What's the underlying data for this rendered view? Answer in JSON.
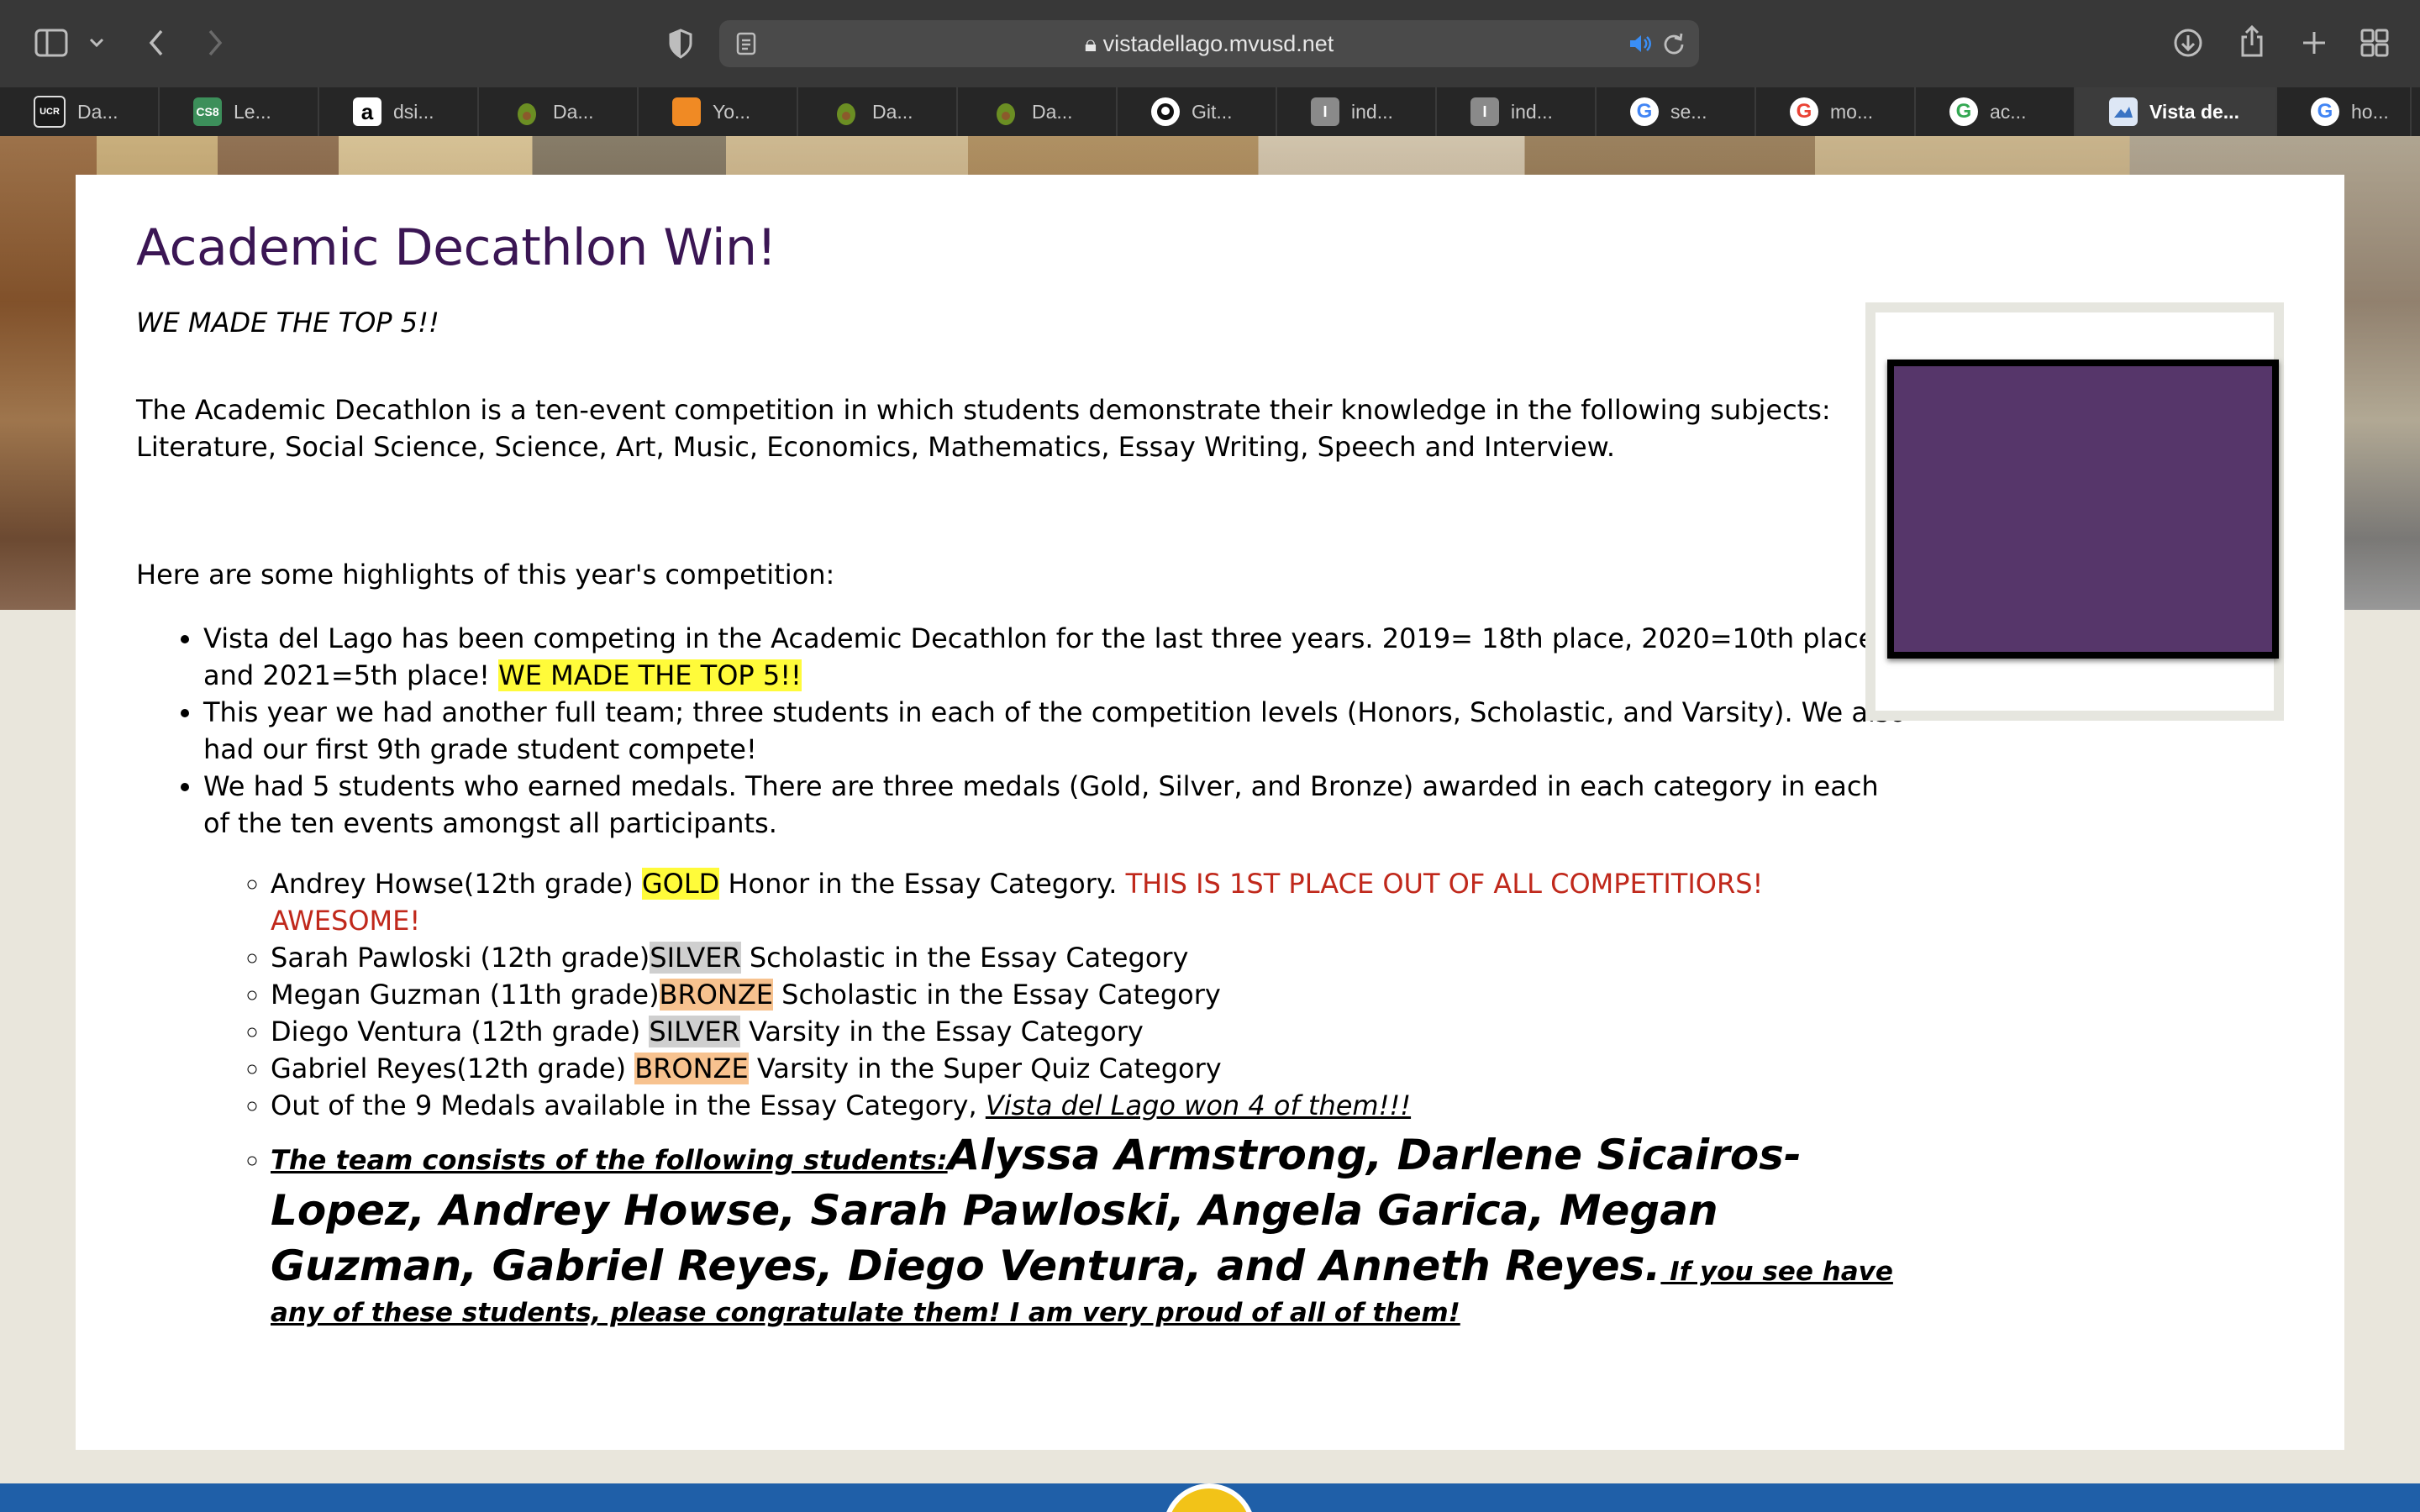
{
  "browser": {
    "url": "vistadellago.mvusd.net",
    "tabs": [
      {
        "label": "Da...",
        "icon": "ucr-learn-icon",
        "color": "#1a1a1a"
      },
      {
        "label": "Le...",
        "icon": "cs8-icon",
        "color": "#3c8f5a"
      },
      {
        "label": "dsi...",
        "icon": "amazon-icon",
        "color": "#ffffff"
      },
      {
        "label": "Da...",
        "icon": "avocado-icon",
        "color": "#6b8e23"
      },
      {
        "label": "Yo...",
        "icon": "orange-box-icon",
        "color": "#f08a24"
      },
      {
        "label": "Da...",
        "icon": "avocado-icon",
        "color": "#6b8e23"
      },
      {
        "label": "Da...",
        "icon": "avocado-icon",
        "color": "#6b8e23"
      },
      {
        "label": "Git...",
        "icon": "github-icon",
        "color": "#ffffff"
      },
      {
        "label": "ind...",
        "icon": "i-icon",
        "color": "#8a8a8a"
      },
      {
        "label": "ind...",
        "icon": "i-icon",
        "color": "#8a8a8a"
      },
      {
        "label": "se...",
        "icon": "google-icon",
        "color": "#ffffff"
      },
      {
        "label": "mo...",
        "icon": "google-icon",
        "color": "#ffffff"
      },
      {
        "label": "ac...",
        "icon": "google-icon",
        "color": "#ffffff"
      },
      {
        "label": "Vista de...",
        "icon": "vista-icon",
        "color": "#dde7f5",
        "active": true
      },
      {
        "label": "ho...",
        "icon": "google-icon",
        "color": "#ffffff"
      }
    ]
  },
  "article": {
    "title": "Academic Decathlon Win!",
    "subtitle": "WE MADE THE TOP 5!!",
    "intro": "The Academic Decathlon is a ten-event competition in which students demonstrate their knowledge in the following subjects: Literature, Social Science, Science, Art, Music, Economics, Mathematics, Essay Writing, Speech and Interview.",
    "highlights_intro": "Here are some highlights of this year's competition:",
    "bullet1_text": "Vista del Lago has been competing in the Academic Decathlon for the last three years. 2019= 18th place, 2020=10th place, and 2021=5th place! ",
    "bullet1_highlight": "WE MADE THE TOP 5!!",
    "bullet2": "This year we had another full team; three students in each of the competition levels (Honors, Scholastic, and Varsity). We also had our first 9th grade student compete!",
    "bullet3": "We had 5 students who earned medals. There are three medals (Gold, Silver, and Bronze) awarded in each category in each of the ten events amongst all participants.",
    "medals": {
      "m1_pre": "Andrey Howse(12th grade) ",
      "m1_medal": "GOLD",
      "m1_post": " Honor in the Essay Category. ",
      "m1_red": "THIS IS 1ST PLACE OUT OF ALL COMPETITIORS! AWESOME!",
      "m2_pre": "Sarah Pawloski (12th grade)",
      "m2_medal": "SILVER",
      "m2_post": " Scholastic in the Essay Category",
      "m3_pre": "Megan Guzman (11th grade)",
      "m3_medal": "BRONZE",
      "m3_post": " Scholastic in the Essay Category",
      "m4_pre": "Diego Ventura (12th grade) ",
      "m4_medal": "SILVER",
      "m4_post": " Varsity in the Essay Category",
      "m5_pre": "Gabriel Reyes(12th grade) ",
      "m5_medal": "BRONZE",
      "m5_post": " Varsity in the Super Quiz Category",
      "m6_pre": "Out of the 9 Medals available in the Essay Category, ",
      "m6_emph": "Vista del Lago won 4 of them!!!"
    },
    "team": {
      "lead": "The team consists of the following students:",
      "names": "Alyssa Armstrong, Darlene Sicairos-Lopez, Andrey Howse, Sarah Pawloski, Angela Garica, Megan Guzman, Gabriel Reyes, Diego Ventura, and Anneth Reyes.",
      "tail": " If you see have any of these students, please congratulate them! I am very proud of all of them!"
    }
  },
  "colors": {
    "title": "#3b1654",
    "side_box": "#56366a",
    "highlight_gold": "#fffb3a",
    "highlight_silver": "#cfcfcf",
    "highlight_bronze": "#f7c28f",
    "red_text": "#c0281b",
    "footer": "#1f5fa8"
  }
}
